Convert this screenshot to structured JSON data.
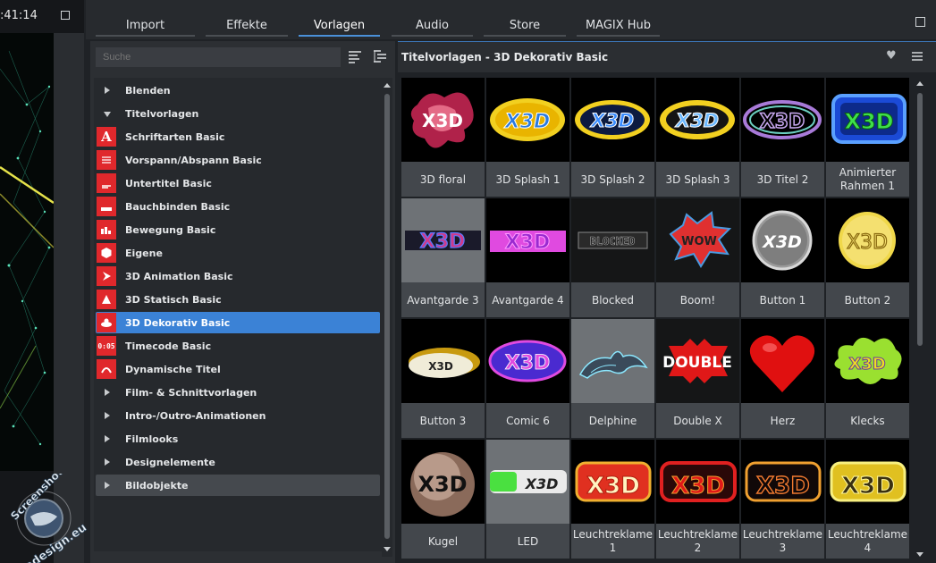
{
  "preview": {
    "time": ":41:14",
    "watermark_text": "Screenshot by Abadesign.eu"
  },
  "tabs": [
    "Import",
    "Effekte",
    "Vorlagen",
    "Audio",
    "Store",
    "MAGIX Hub"
  ],
  "active_tab": "Vorlagen",
  "search": {
    "placeholder": "Suche",
    "value": ""
  },
  "tree": {
    "items": [
      {
        "label": "Blenden",
        "type": "group",
        "expanded": false
      },
      {
        "label": "Titelvorlagen",
        "type": "group",
        "expanded": true
      },
      {
        "label": "Schriftarten Basic",
        "type": "child",
        "icon": "font-a-icon"
      },
      {
        "label": "Vorspann/Abspann Basic",
        "type": "child",
        "icon": "credits-icon"
      },
      {
        "label": "Untertitel Basic",
        "type": "child",
        "icon": "subtitle-icon"
      },
      {
        "label": "Bauchbinden Basic",
        "type": "child",
        "icon": "lower-third-icon"
      },
      {
        "label": "Bewegung Basic",
        "type": "child",
        "icon": "motion-icon"
      },
      {
        "label": "Eigene",
        "type": "child",
        "icon": "hexagon-icon"
      },
      {
        "label": "3D Animation Basic",
        "type": "child",
        "icon": "3d-animation-icon"
      },
      {
        "label": "3D Statisch Basic",
        "type": "child",
        "icon": "3d-static-icon"
      },
      {
        "label": "3D Dekorativ Basic",
        "type": "child",
        "icon": "3d-decorative-icon",
        "selected": true
      },
      {
        "label": "Timecode Basic",
        "type": "child",
        "icon": "timecode-icon",
        "icon_text": "0:05"
      },
      {
        "label": "Dynamische Titel",
        "type": "child",
        "icon": "dynamic-title-icon"
      },
      {
        "label": "Film- & Schnittvorlagen",
        "type": "group",
        "expanded": false
      },
      {
        "label": "Intro-/Outro-Animationen",
        "type": "group",
        "expanded": false
      },
      {
        "label": "Filmlooks",
        "type": "group",
        "expanded": false
      },
      {
        "label": "Designelemente",
        "type": "group",
        "expanded": false
      },
      {
        "label": "Bildobjekte",
        "type": "group",
        "expanded": false,
        "highlighted": true
      }
    ]
  },
  "gallery": {
    "title": "Titelvorlagen - 3D Dekorativ Basic",
    "tiles": [
      {
        "label": "3D floral",
        "art": "X3D"
      },
      {
        "label": "3D Splash 1",
        "art": "X3D"
      },
      {
        "label": "3D Splash 2",
        "art": "X3D"
      },
      {
        "label": "3D Splash 3",
        "art": "X3D"
      },
      {
        "label": "3D Titel 2",
        "art": "X3D"
      },
      {
        "label": "Animierter Rahmen 1",
        "art": "X3D"
      },
      {
        "label": "Avantgarde 3",
        "art": "X3D"
      },
      {
        "label": "Avantgarde 4",
        "art": "X3D"
      },
      {
        "label": "Blocked",
        "art": "BLOCKED"
      },
      {
        "label": "Boom!",
        "art": "WOW"
      },
      {
        "label": "Button 1",
        "art": "X3D"
      },
      {
        "label": "Button 2",
        "art": "X3D"
      },
      {
        "label": "Button 3",
        "art": "X3D"
      },
      {
        "label": "Comic 6",
        "art": "X3D"
      },
      {
        "label": "Delphine",
        "art": ""
      },
      {
        "label": "Double X",
        "art": "DOUBLE"
      },
      {
        "label": "Herz",
        "art": ""
      },
      {
        "label": "Klecks",
        "art": "X3D"
      },
      {
        "label": "Kugel",
        "art": "X3D"
      },
      {
        "label": "LED",
        "art": "X3D"
      },
      {
        "label": "Leuchtreklame 1",
        "art": "X3D"
      },
      {
        "label": "Leuchtreklame 2",
        "art": "X3D"
      },
      {
        "label": "Leuchtreklame 3",
        "art": "X3D"
      },
      {
        "label": "Leuchtreklame 4",
        "art": "X3D"
      }
    ]
  },
  "colors": {
    "accent": "#3b82d6",
    "icon_red": "#e0282c"
  }
}
